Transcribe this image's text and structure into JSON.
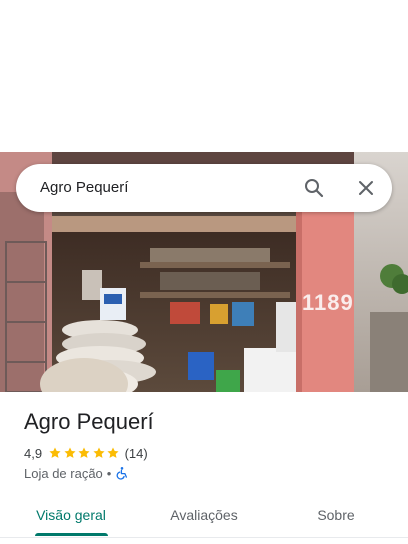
{
  "search": {
    "query": "Agro Pequerí"
  },
  "place": {
    "name": "Agro Pequerí",
    "rating": "4,9",
    "stars": 5,
    "review_count": "(14)",
    "category": "Loja de ração",
    "separator": "•",
    "storefront_number": "1189"
  },
  "tabs": [
    {
      "label": "Visão geral",
      "active": true
    },
    {
      "label": "Avaliações",
      "active": false
    },
    {
      "label": "Sobre",
      "active": false
    }
  ],
  "colors": {
    "accent": "#00796b",
    "star": "#fbbc04",
    "accessibility": "#1a73e8"
  },
  "icons": [
    "search-icon",
    "close-icon",
    "star-icon",
    "wheelchair-icon"
  ]
}
